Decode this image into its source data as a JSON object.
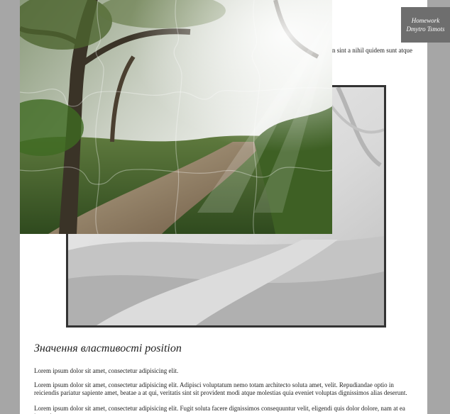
{
  "badge": {
    "line1": "Homework",
    "line2": "Dmytro Tsmots"
  },
  "partially_hidden_text": "n sint a nihil quidem sunt atque",
  "section": {
    "heading": "Значення властивості position"
  },
  "paragraphs": [
    "Lorem ipsum dolor sit amet, consectetur adipisicing elit.",
    "Lorem ipsum dolor sit amet, consectetur adipisicing elit. Adipisci voluptatum nemo totam architecto soluta amet, velit. Repudiandae optio in reiciendis pariatur sapiente amet, beatae a at qui, veritatis sint sit provident modi atque molestias quia eveniet voluptas dignissimos alias deserunt.",
    "Lorem ipsum dolor sit amet, consectetur adipisicing elit. Fugit soluta facere dignissimos consequuntur velit, eligendi quis dolor dolore, nam at ea ipsum!"
  ],
  "colors": {
    "background": "#a6a6a6",
    "badge": "#6e6e6e",
    "frame_border": "#333333"
  }
}
